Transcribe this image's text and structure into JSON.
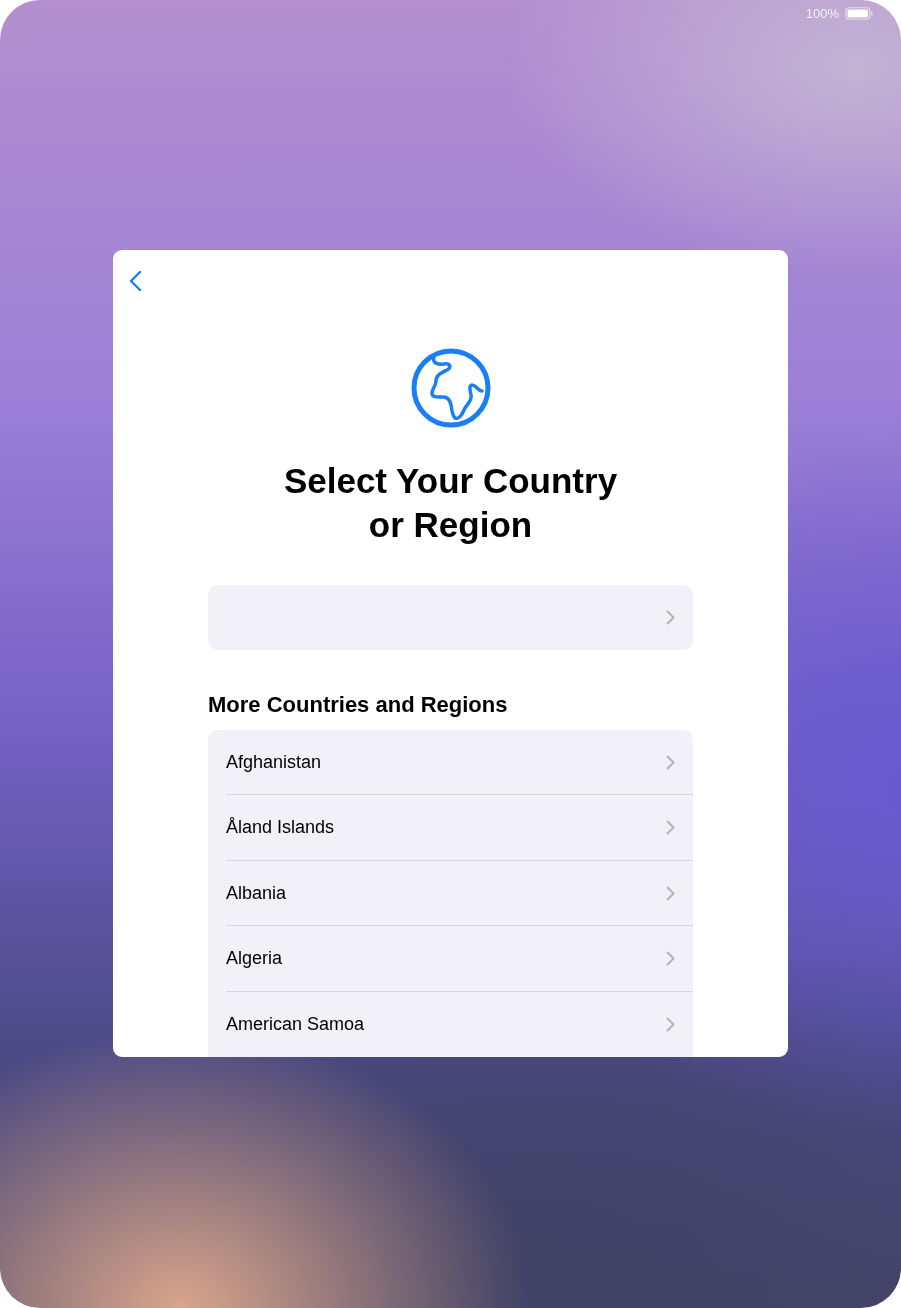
{
  "status_bar": {
    "battery_text": "100%"
  },
  "title_lines": [
    "Select Your Country",
    "or Region"
  ],
  "section_header": "More Countries and Regions",
  "countries": [
    {
      "name": "Afghanistan"
    },
    {
      "name": "Åland Islands"
    },
    {
      "name": "Albania"
    },
    {
      "name": "Algeria"
    },
    {
      "name": "American Samoa"
    }
  ]
}
